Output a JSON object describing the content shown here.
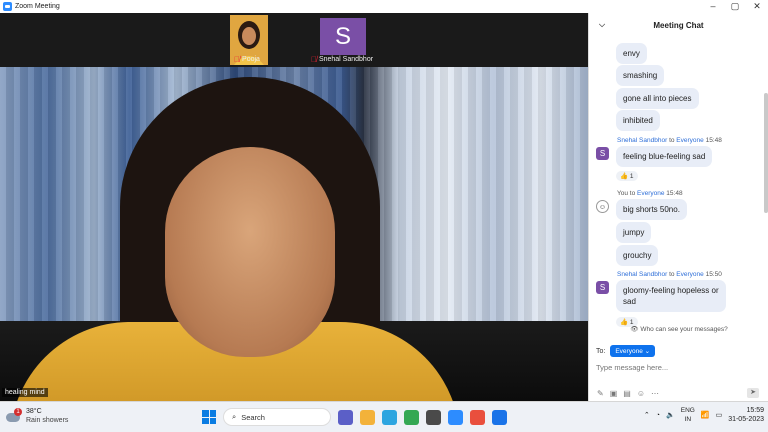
{
  "window": {
    "title": "Zoom Meeting",
    "controls": [
      "–",
      "▢",
      "✕"
    ]
  },
  "participants": [
    {
      "name": "Pooja",
      "muted": true
    },
    {
      "name": "Snehal Sandbhor",
      "muted": true,
      "avatar_letter": "S"
    }
  ],
  "main_video": {
    "name_label": "healing mind"
  },
  "chat": {
    "title": "Meeting Chat",
    "messages_top": [
      "envy",
      "smashing",
      "gone all into pieces",
      "inhibited"
    ],
    "msg1": {
      "sender": "Snehal Sandbhor",
      "to_word": "to",
      "to": "Everyone",
      "time": "15:48",
      "avatar": "S",
      "text": "feeling blue-feeling sad",
      "reaction": "👍 1"
    },
    "msg2": {
      "sender": "You",
      "to_word": "to",
      "to": "Everyone",
      "time": "15:48",
      "texts": [
        "big shorts 50no.",
        "jumpy",
        "grouchy"
      ]
    },
    "msg3": {
      "sender": "Snehal Sandbhor",
      "to_word": "to",
      "to": "Everyone",
      "time": "15:50",
      "avatar": "S",
      "text_line1": "gloomy-feeling hopeless or",
      "text_line2": "sad",
      "reaction": "👍 1"
    },
    "privacy_text": "Who can see your messages?",
    "to_label": "To:",
    "recipient": "Everyone",
    "placeholder": "Type message here..."
  },
  "taskbar": {
    "weather_temp": "38°C",
    "weather_desc": "Rain showers",
    "alert_count": "1",
    "search_label": "Search",
    "lang_line1": "ENG",
    "lang_line2": "IN",
    "time": "15:59",
    "date": "31-05-2023",
    "app_colors": [
      "#5b5fc7",
      "#f3b23a",
      "#2da5e0",
      "#34a853",
      "#4a4a4a",
      "#2d8cff",
      "#e94f3d",
      "#1a73e8"
    ]
  }
}
